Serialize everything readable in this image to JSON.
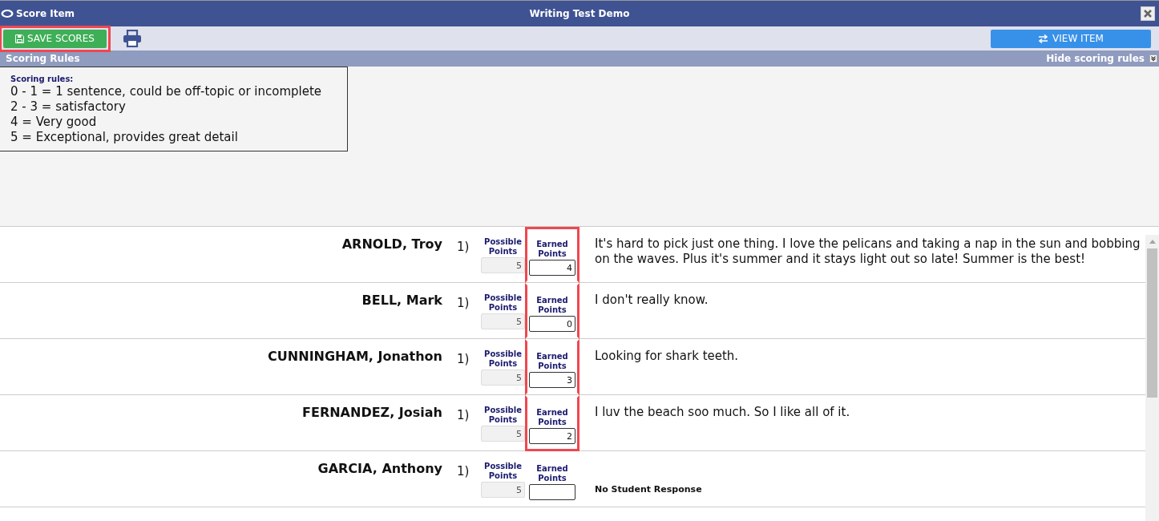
{
  "window": {
    "title": "Score Item",
    "subtitle": "Writing Test Demo"
  },
  "toolbar": {
    "save_button": {
      "label": "SAVE SCORES",
      "highlighted": true
    },
    "view_button": {
      "label": "VIEW ITEM"
    }
  },
  "scoring_rules": {
    "header": "Scoring Rules",
    "toggle": "Hide scoring rules",
    "expanded": true,
    "heading": "Scoring rules:",
    "lines": [
      "0 - 1 = 1 sentence, could be off-topic or incomplete",
      "2 - 3 = satisfactory",
      "4 = Very good",
      "5 = Exceptional, provides great detail"
    ]
  },
  "students": [
    {
      "name": "ARNOLD, Troy",
      "number": "1)",
      "possible_label": "Possible Points",
      "possible": "5",
      "earned_label": "Earned Points",
      "earned": "4",
      "highlighted": true,
      "response": {
        "kind": "text",
        "text": "It's hard to pick just one thing. I love the pelicans and taking a nap in the sun and bobbing on the waves. Plus it's summer and it stays light out so late! Summer is the best!"
      }
    },
    {
      "name": "BELL, Mark",
      "number": "1)",
      "possible_label": "Possible Points",
      "possible": "5",
      "earned_label": "Earned Points",
      "earned": "0",
      "highlighted": true,
      "response": {
        "kind": "text",
        "text": "I don't really know."
      }
    },
    {
      "name": "CUNNINGHAM, Jonathon",
      "number": "1)",
      "possible_label": "Possible Points",
      "possible": "5",
      "earned_label": "Earned Points",
      "earned": "3",
      "highlighted": true,
      "response": {
        "kind": "text",
        "text": "Looking for shark teeth."
      }
    },
    {
      "name": "FERNANDEZ, Josiah",
      "number": "1)",
      "possible_label": "Possible Points",
      "possible": "5",
      "earned_label": "Earned Points",
      "earned": "2",
      "highlighted": true,
      "response": {
        "kind": "text",
        "text": "I luv the beach soo much. So I like all of it."
      }
    },
    {
      "name": "GARCIA, Anthony",
      "number": "1)",
      "possible_label": "Possible Points",
      "possible": "5",
      "earned_label": "Earned Points",
      "highlighted": false,
      "response": {
        "kind": "none",
        "text": "No Student Response"
      }
    }
  ]
}
